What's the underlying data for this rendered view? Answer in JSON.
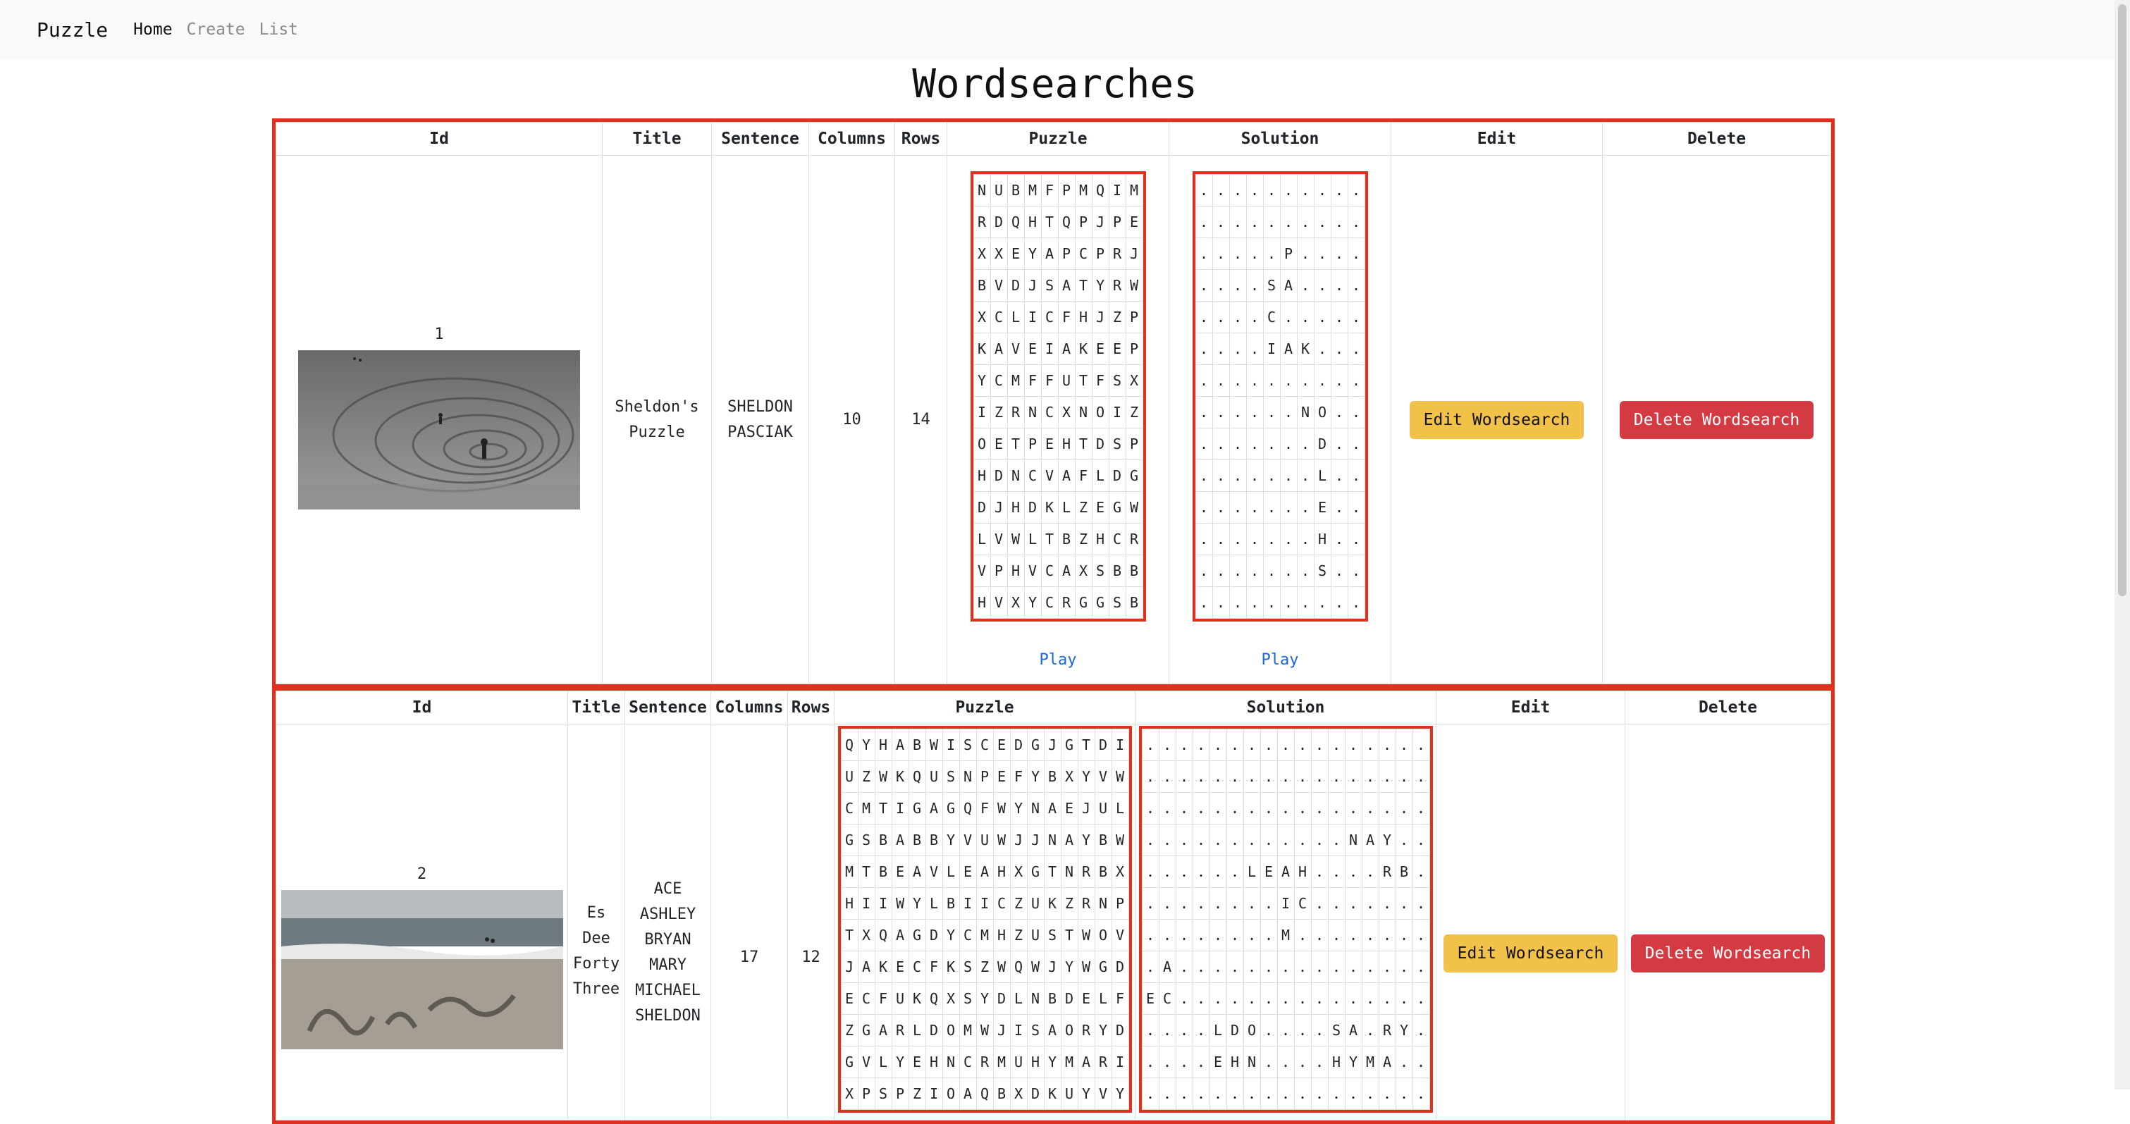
{
  "nav": {
    "brand": "Puzzle",
    "links": [
      "Home",
      "Create",
      "List"
    ]
  },
  "page": {
    "title": "Wordsearches"
  },
  "table": {
    "headers": [
      "Id",
      "Title",
      "Sentence",
      "Columns",
      "Rows",
      "Puzzle",
      "Solution",
      "Edit",
      "Delete"
    ]
  },
  "puzzles": [
    {
      "id": "1",
      "title": "Sheldon's Puzzle",
      "sentence": "SHELDON PASCIAK",
      "columns": "10",
      "rows": "14",
      "image": "beach-sand-spiral-photo",
      "puzzle_rows": [
        "NUBMFPMQIM",
        "RDQHTQPJPE",
        "XXEYAPCPRJ",
        "BVDJSATYRW",
        "XCLICFHJZP",
        "KAVEIAKEEP",
        "YCMFFUTFSX",
        "IZRNCXNOIZ",
        "OETPEHTDSP",
        "HDNCVAFLDG",
        "DJHDKLZEGW",
        "LVWLTBZHCR",
        "VPHVCAXSBB",
        "HVXYCRGGSB"
      ],
      "solution_rows": [
        "..........",
        "..........",
        ".....P....",
        "....SA....",
        "....C.....",
        "....IAK...",
        "..........",
        "......NO..",
        ".......D..",
        ".......L..",
        ".......E..",
        ".......H..",
        ".......S..",
        ".........."
      ],
      "play_puzzle": "Play",
      "play_solution": "Play",
      "edit_label": "Edit Wordsearch",
      "delete_label": "Delete Wordsearch"
    },
    {
      "id": "2",
      "title": "Es Dee Forty Three",
      "sentence": "ACE ASHLEY BRYAN MARY MICHAEL SHELDON",
      "columns": "17",
      "rows": "12",
      "image": "beach-sand-writing-photo",
      "puzzle_rows": [
        "QYHABWISCEDGJGTDI",
        "UZWKQUSNPEFYBXYVW",
        "CMTIGAGQFWYNAEJUL",
        "GSBABBYVUWJJNAYBW",
        "MTBEAVLEAHXGTNRBX",
        "HIIWYLBIICZUKZRNP",
        "TXQAGDYCMHZUSTWOV",
        "JAKECFKSZWQWJYWGD",
        "ECFUKQXSYDLNBDELF",
        "ZGARLDOMWJISAORYD",
        "GVLYEHNCRMUHYMARI",
        "XPSPZIOAQBXDKUYVY"
      ],
      "solution_rows": [
        ".................",
        ".................",
        ".................",
        "............NAY..",
        "......LEAH....RB.",
        "........IC.......",
        "........M........",
        ".A...............",
        "EC...............",
        "....LDO....SA.RY.",
        "....EHN....HYMA..",
        "................."
      ],
      "edit_label": "Edit Wordsearch",
      "delete_label": "Delete Wordsearch"
    }
  ]
}
